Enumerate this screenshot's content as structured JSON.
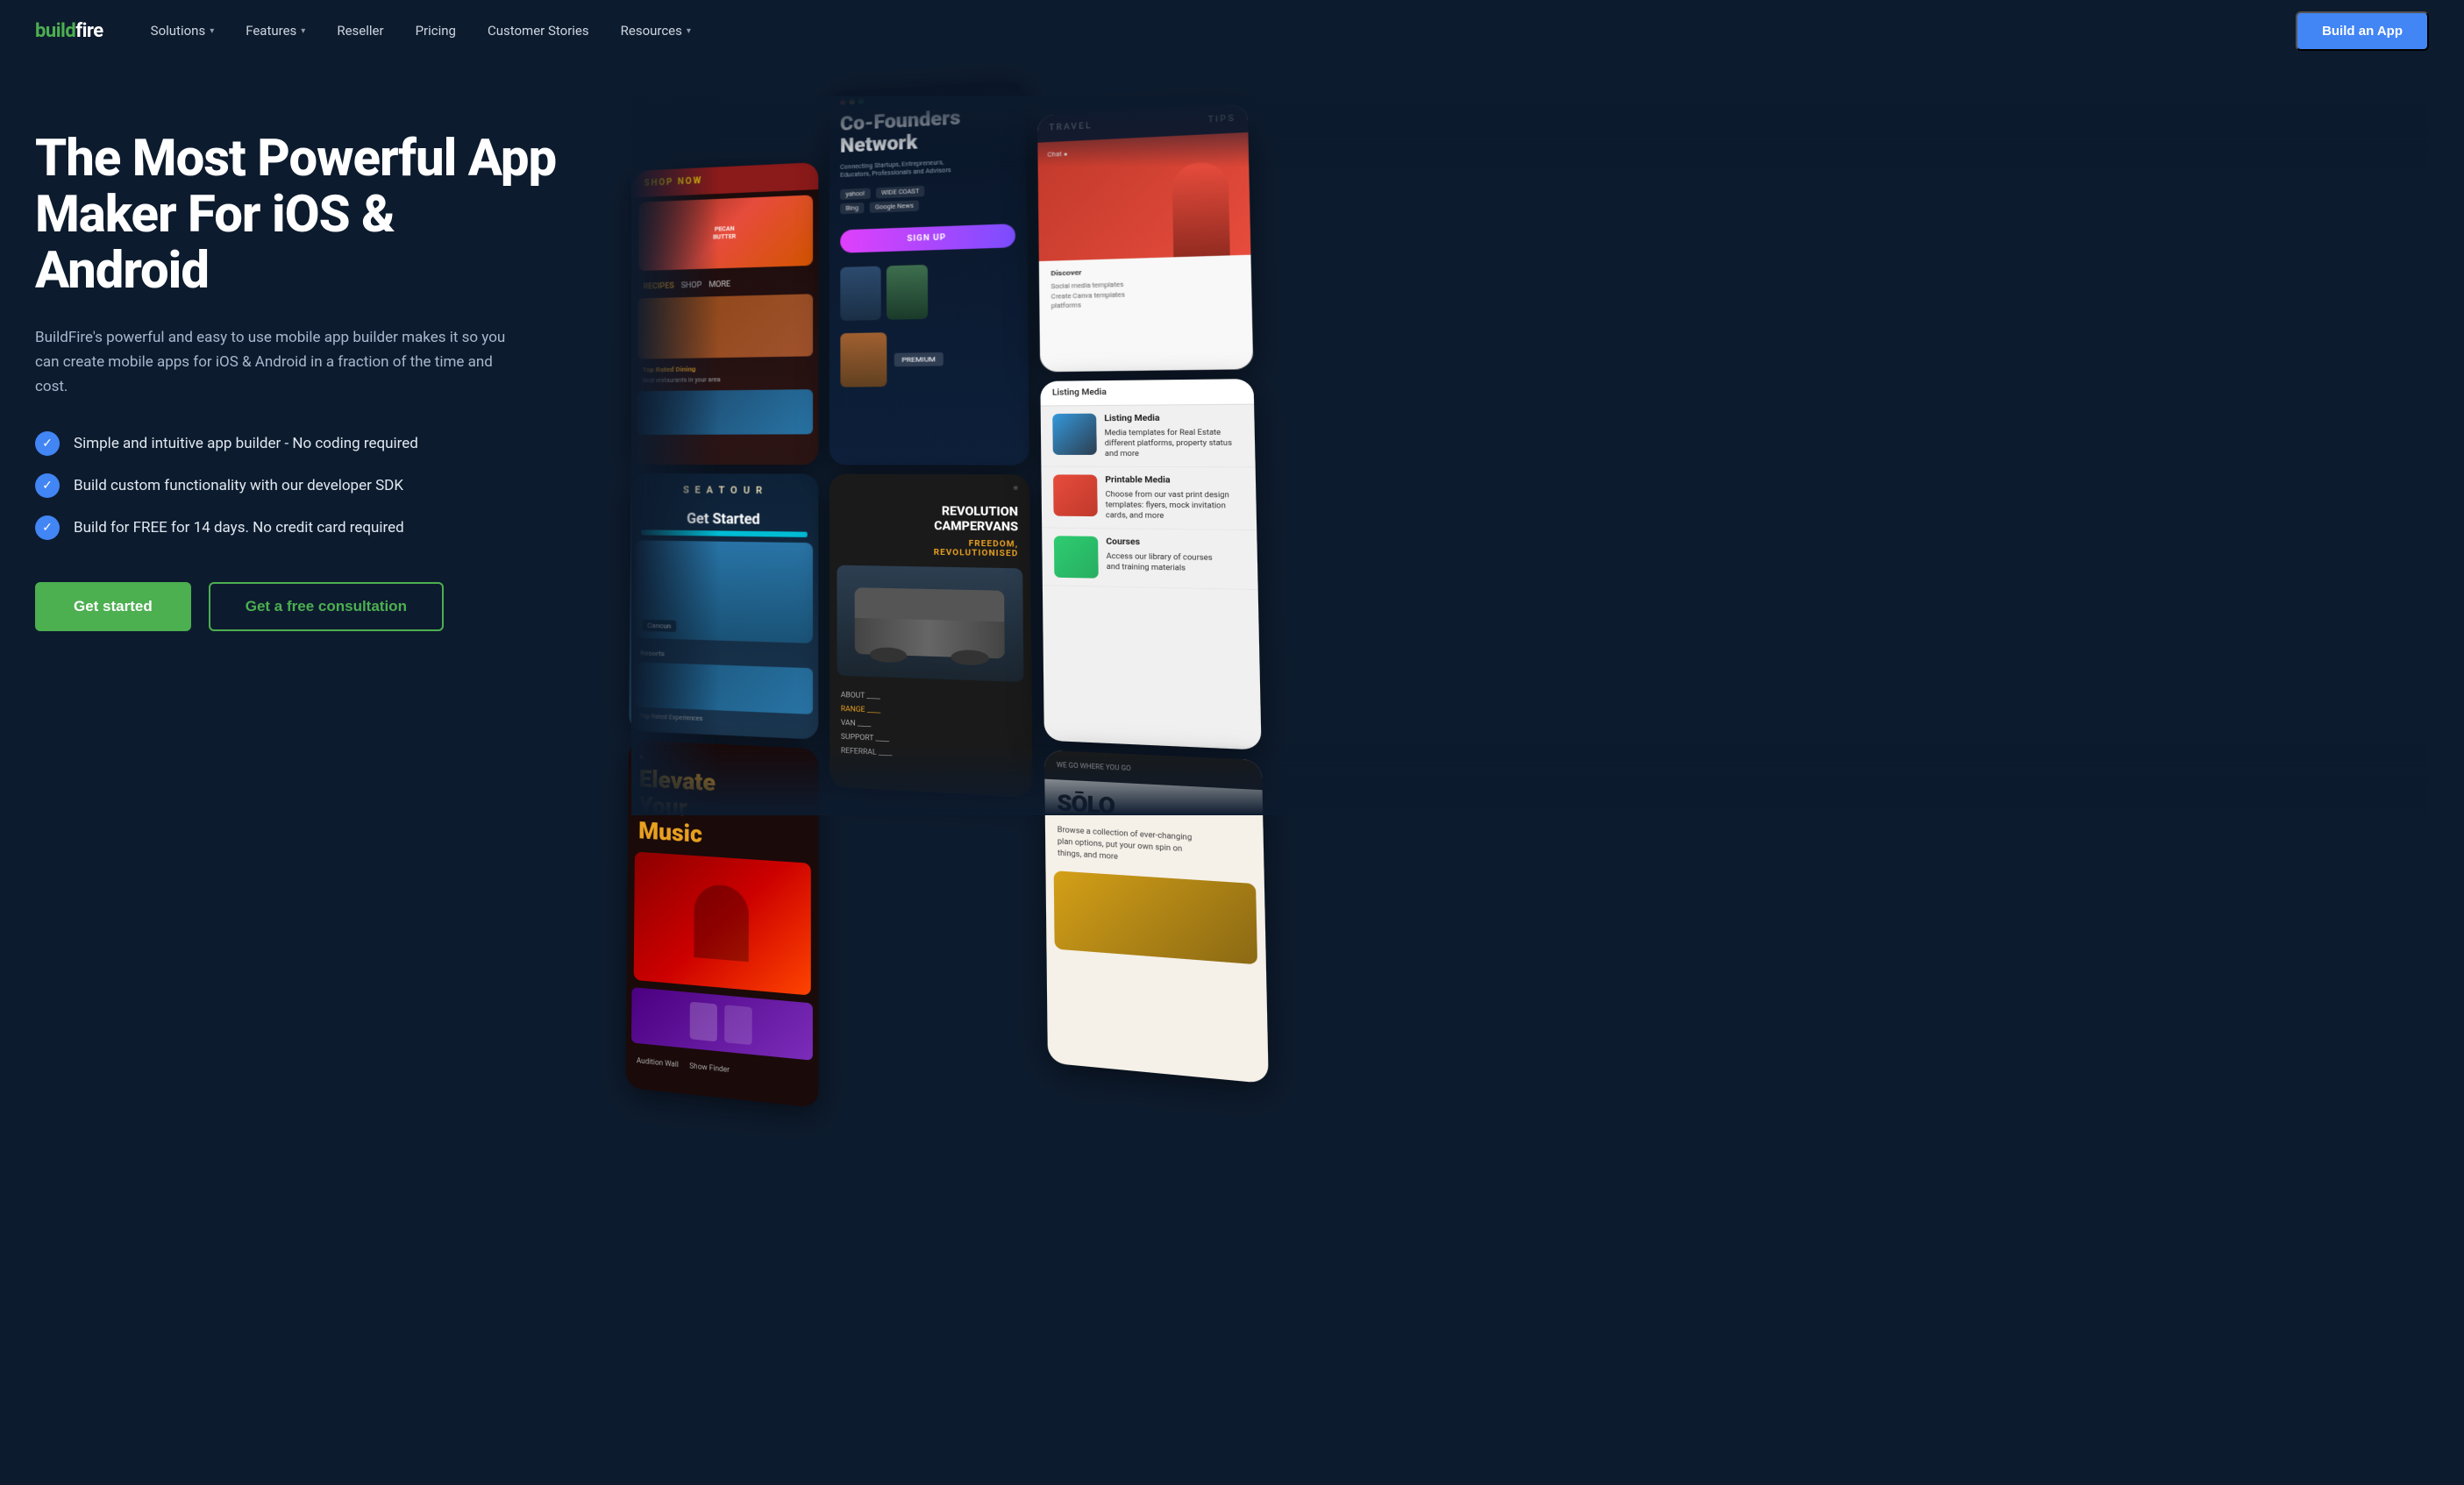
{
  "nav": {
    "logo_text": "buildfire",
    "links": [
      {
        "label": "Solutions",
        "has_dropdown": true
      },
      {
        "label": "Features",
        "has_dropdown": true
      },
      {
        "label": "Reseller",
        "has_dropdown": false
      },
      {
        "label": "Pricing",
        "has_dropdown": false
      },
      {
        "label": "Customer Stories",
        "has_dropdown": false
      },
      {
        "label": "Resources",
        "has_dropdown": true
      }
    ],
    "cta_label": "Build an App"
  },
  "hero": {
    "title": "The Most Powerful App Maker For iOS & Android",
    "subtitle": "BuildFire's powerful and easy to use mobile app builder makes it so you can create mobile apps for iOS & Android in a fraction of the time and cost.",
    "checklist": [
      "Simple and intuitive app builder - No coding required",
      "Build custom functionality with our developer SDK",
      "Build for FREE for 14 days. No credit card required"
    ],
    "btn_primary": "Get started",
    "btn_secondary": "Get a free consultation"
  },
  "apps": {
    "col1": [
      {
        "type": "food",
        "title": "SHOP NOW",
        "subtitle": "PECAN BUTTER",
        "section": "RECIPES"
      },
      {
        "type": "travel",
        "title": "SEATOUR",
        "subtitle": "Get Started",
        "section": "Resorts"
      },
      {
        "type": "music",
        "title": "Elevate Your Music"
      }
    ],
    "col2": [
      {
        "type": "network",
        "title": "Co-Founders Network",
        "sub": "Connecting Startups, Entrepreneurs, Educators, Professionals and Advisors",
        "btn": "SIGN UP"
      },
      {
        "type": "campervan",
        "title": "REVOLUTION CAMPERVANS",
        "sub": "FREEDOM REVOLUTIONISED"
      }
    ],
    "col3": [
      {
        "type": "travel2",
        "title": "TRAVEL TIPS"
      },
      {
        "type": "listing",
        "title": "Listing Media"
      },
      {
        "type": "solo",
        "title": "SŌLO"
      }
    ]
  }
}
